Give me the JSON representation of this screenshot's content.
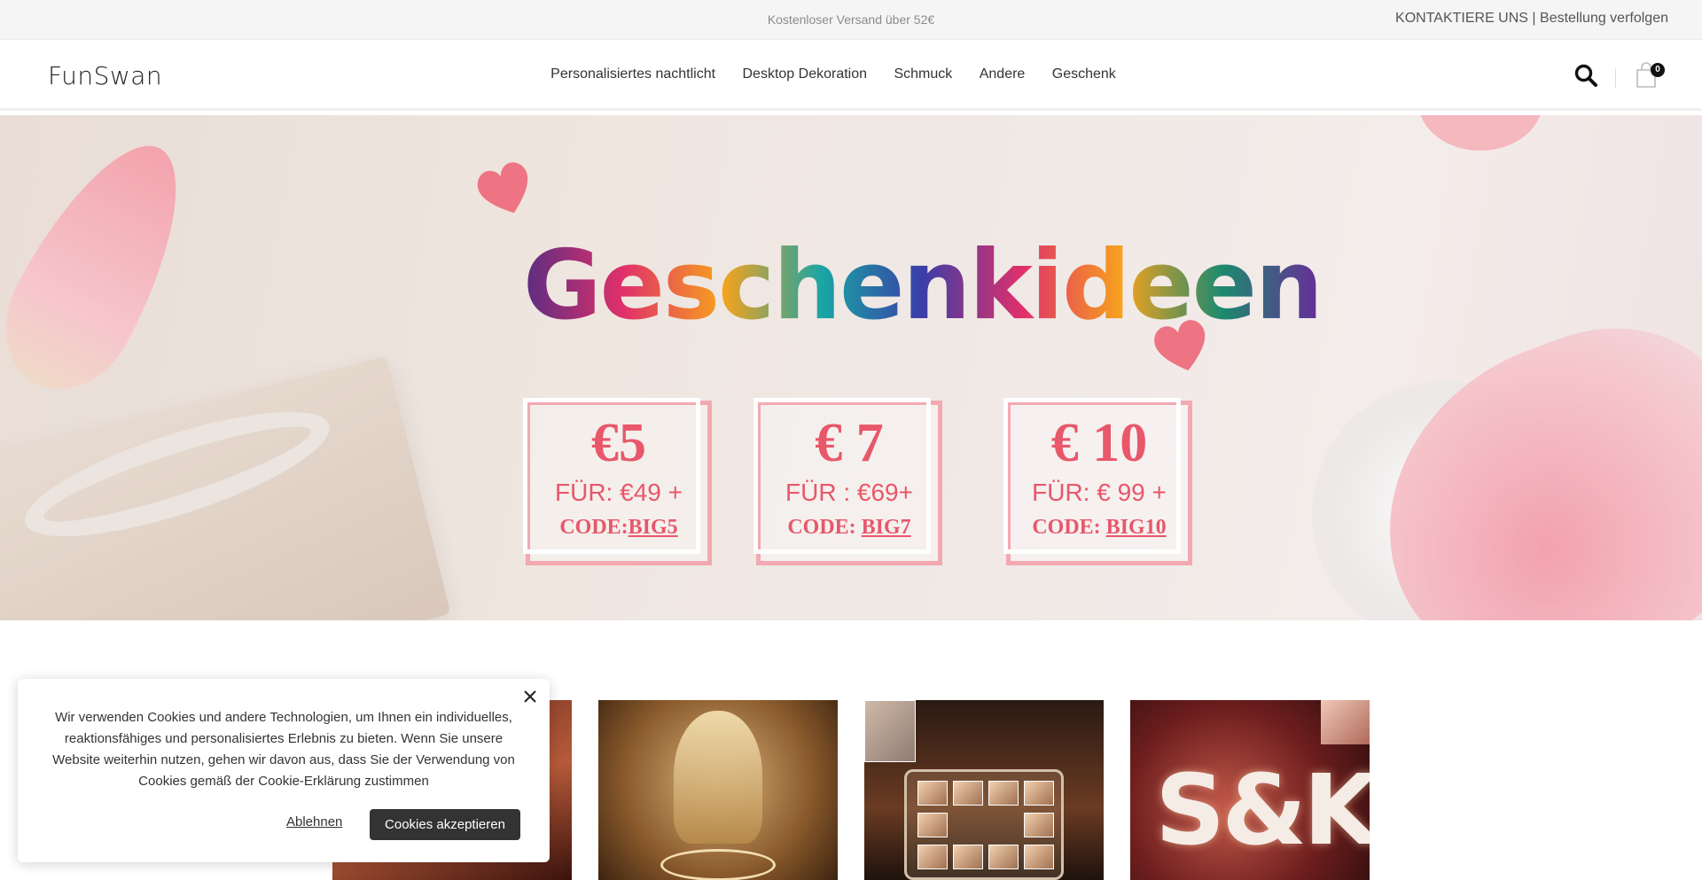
{
  "topbar": {
    "promo": "Kostenloser Versand über 52€",
    "contact": "KONTAKTIERE UNS",
    "separator": " | ",
    "track_order": "Bestellung verfolgen"
  },
  "header": {
    "logo": "FunSwan",
    "nav": [
      {
        "label": "Personalisiertes nachtlicht"
      },
      {
        "label": "Desktop Dekoration"
      },
      {
        "label": "Schmuck"
      },
      {
        "label": "Andere"
      },
      {
        "label": "Geschenk"
      }
    ],
    "cart_count": "0"
  },
  "hero": {
    "headline": "Geschenkideen",
    "coupons": [
      {
        "amount": "€5",
        "for": "FÜR: €49 +",
        "code_label": "CODE:",
        "code": "BIG5"
      },
      {
        "amount": "€ 7",
        "for": "FÜR : €69+",
        "code_label": "CODE: ",
        "code": "BIG7"
      },
      {
        "amount": "€ 10",
        "for": "FÜR: € 99 +",
        "code_label": "CODE: ",
        "code": "BIG10"
      }
    ]
  },
  "cookie": {
    "text": "Wir verwenden Cookies und andere Technologien, um Ihnen ein individuelles, reaktionsfähiges und personalisiertes Erlebnis zu bieten. Wenn Sie unsere Website weiterhin nutzen, gehen wir davon aus, dass Sie der Verwendung von Cookies gemäß der Cookie-Erklärung zustimmen",
    "decline": "Ablehnen",
    "accept": "Cookies akzeptieren"
  },
  "products": {
    "p4_letters": "S&K"
  },
  "colors": {
    "accent_pink": "#e8576a",
    "button_dark": "#333333"
  }
}
